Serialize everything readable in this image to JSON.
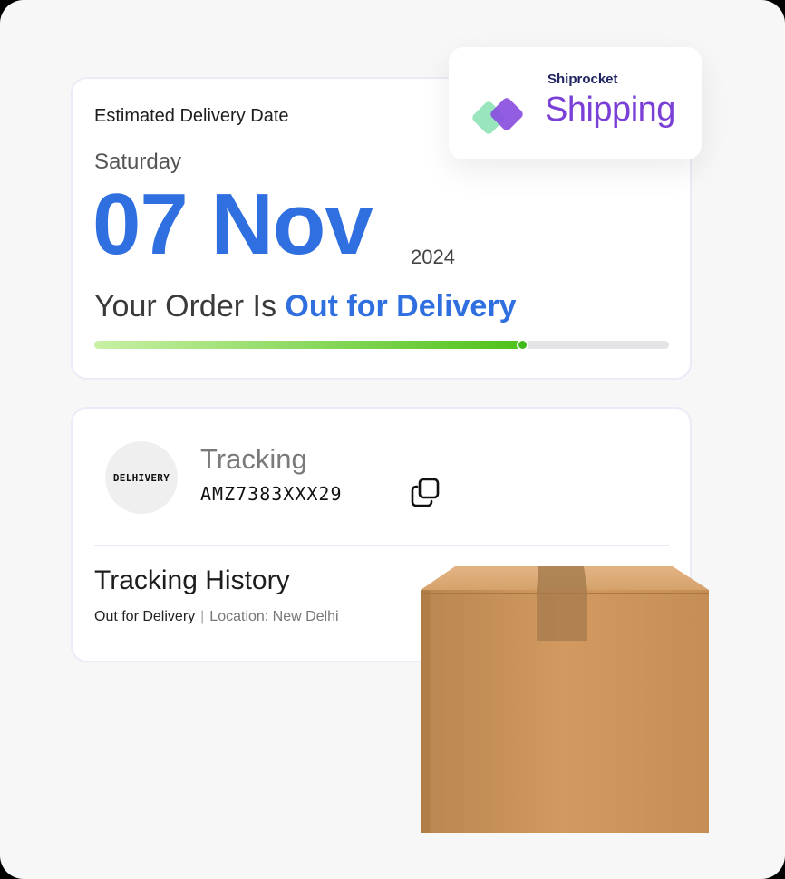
{
  "delivery": {
    "estimated_label": "Estimated Delivery Date",
    "weekday": "Saturday",
    "date_main": "07 Nov",
    "year": "2024",
    "status_prefix": "Your Order Is",
    "status_value": "Out for Delivery",
    "progress": 0.745
  },
  "brand": {
    "name": "Shiprocket",
    "product": "Shipping"
  },
  "tracking": {
    "courier_logo_text": "DELHIVERY",
    "label": "Tracking",
    "awb": "AMZ7383XXX29",
    "history_title": "Tracking History",
    "history_status": "Out for Delivery",
    "history_separator": "|",
    "history_location": "Location: New Delhi"
  },
  "icons": {
    "copy": "copy-icon",
    "brand_mark": "shiprocket-logo-icon",
    "package": "cardboard-box-icon"
  },
  "colors": {
    "accent_blue": "#2f6fe0",
    "progress_green": "#4fc21a",
    "brand_purple": "#7a3fd6"
  }
}
